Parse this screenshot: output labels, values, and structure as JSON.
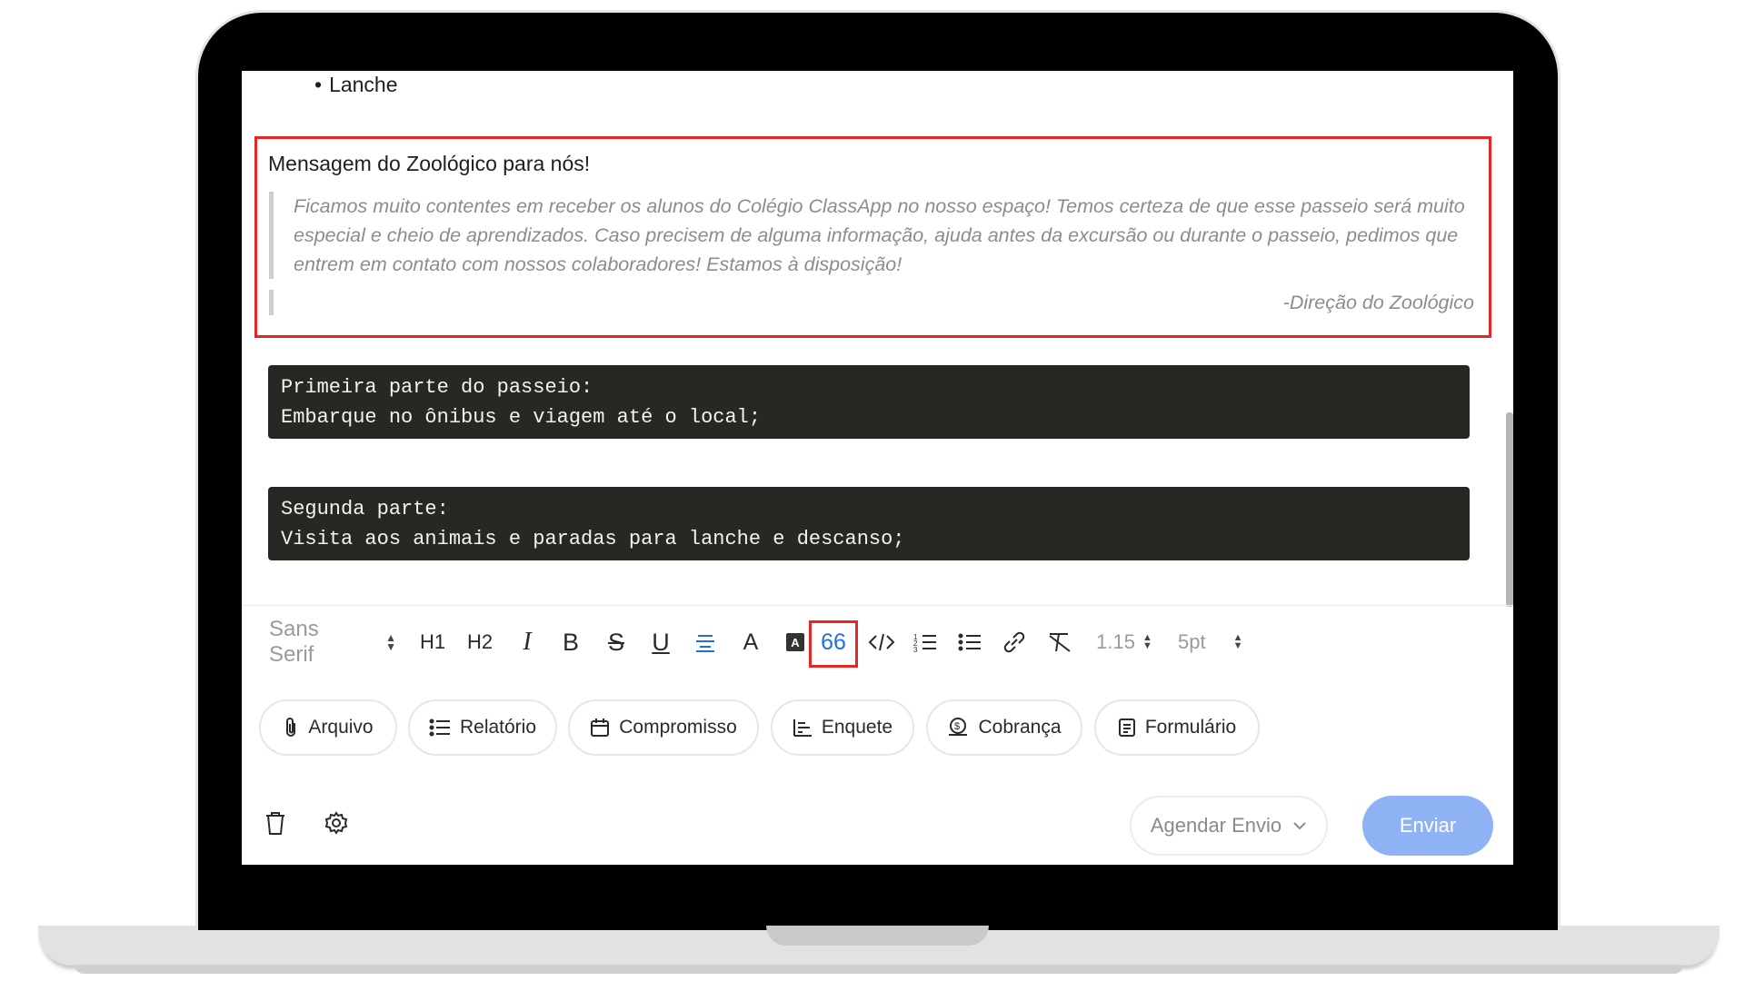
{
  "content": {
    "bullet_item": "Lanche",
    "quote_title": "Mensagem do Zoológico para nós!",
    "quote_text": "Ficamos muito contentes em receber os alunos do Colégio ClassApp no nosso espaço!  Temos certeza de que esse passeio será muito especial e cheio de aprendizados. Caso precisem de alguma informação, ajuda antes da excursão ou durante o passeio, pedimos que entrem em contato com nossos colaboradores! Estamos à disposição!",
    "quote_signature": "-Direção do Zoológico",
    "code_block_1": [
      "Primeira parte do passeio:",
      "Embarque no ônibus e viagem até o local;"
    ],
    "code_block_2": [
      "Segunda parte:",
      "Visita aos animais e paradas para lanche e descanso;"
    ]
  },
  "toolbar": {
    "font_family": "Sans Serif",
    "h1": "H1",
    "h2": "H2",
    "italic": "I",
    "bold": "B",
    "strike": "S",
    "underline": "U",
    "font_color": "A",
    "bg_color": "A",
    "quote": "66",
    "line_height": "1.15",
    "font_size": "5pt"
  },
  "attachments": {
    "file": "Arquivo",
    "report": "Relatório",
    "appointment": "Compromisso",
    "poll": "Enquete",
    "charge": "Cobrança",
    "form": "Formulário"
  },
  "actions": {
    "schedule": "Agendar Envio",
    "send": "Enviar"
  },
  "colors": {
    "highlight_border": "#e32626",
    "active_blue": "#1f6fe0",
    "send_button": "#8fb2f5",
    "code_background": "#272824"
  }
}
